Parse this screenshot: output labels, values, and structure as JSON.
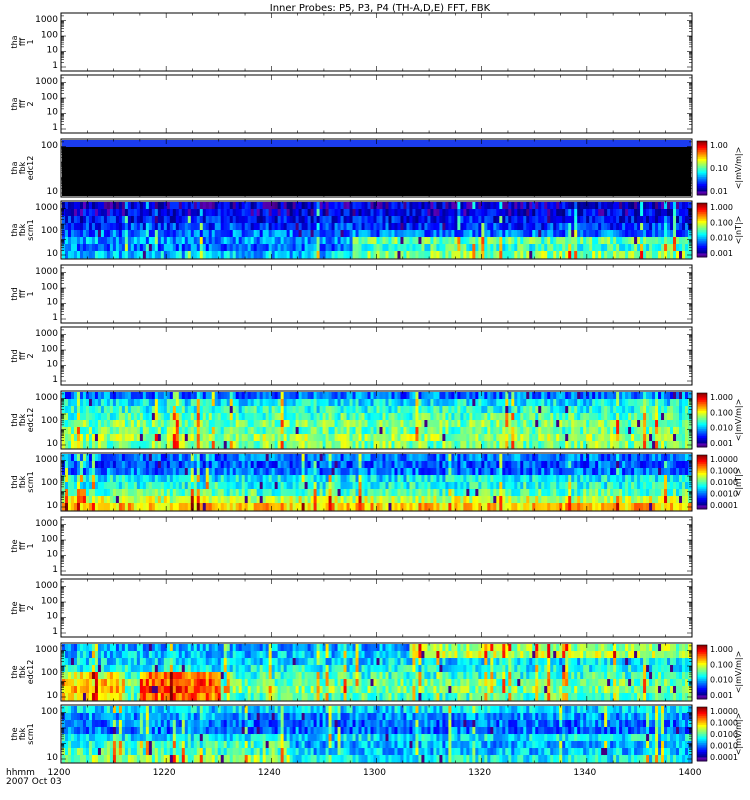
{
  "title": "Inner Probes: P5, P3, P4 (TH-A,D,E) FFT, FBK",
  "footer": {
    "time_label": "hhmm",
    "date_label": "2007 Oct 03"
  },
  "chart_data": {
    "type": "heatmap",
    "x_axis": {
      "ticks": [
        "1200",
        "1220",
        "1240",
        "1300",
        "1320",
        "1340",
        "1400"
      ],
      "range": [
        "12:00",
        "14:00"
      ]
    },
    "panels": [
      {
        "id": "tha-fff1",
        "ylabel": [
          "tha",
          "fff",
          "1"
        ],
        "yticks": [
          "1000",
          "100",
          "10",
          "1"
        ],
        "empty": true
      },
      {
        "id": "tha-fff2",
        "ylabel": [
          "tha",
          "fff",
          "2"
        ],
        "yticks": [
          "1000",
          "100",
          "10",
          "1"
        ],
        "empty": true
      },
      {
        "id": "tha-fbk-edc12",
        "ylabel": [
          "tha",
          "fbk",
          "edc12"
        ],
        "yticks": [
          "100",
          "10"
        ],
        "style": "black",
        "colorbar": {
          "ticks": [
            "1.00",
            "0.10",
            "0.01"
          ],
          "unit": "<|mV/m|>"
        }
      },
      {
        "id": "tha-fbk-scm1",
        "ylabel": [
          "tha",
          "fbk",
          "scm1"
        ],
        "yticks": [
          "1000",
          "100",
          "10"
        ],
        "style": "scmA",
        "colorbar": {
          "ticks": [
            "1.000",
            "0.100",
            "0.010",
            "0.001"
          ],
          "unit": "<|nT|>"
        }
      },
      {
        "id": "thd-fff1",
        "ylabel": [
          "thd",
          "fff",
          "1"
        ],
        "yticks": [
          "1000",
          "100",
          "10",
          "1"
        ],
        "empty": true
      },
      {
        "id": "thd-fff2",
        "ylabel": [
          "thd",
          "fff",
          "2"
        ],
        "yticks": [
          "1000",
          "100",
          "10",
          "1"
        ],
        "empty": true
      },
      {
        "id": "thd-fbk-edc12",
        "ylabel": [
          "thd",
          "fbk",
          "edc12"
        ],
        "yticks": [
          "1000",
          "100",
          "10"
        ],
        "style": "edcD",
        "colorbar": {
          "ticks": [
            "1.000",
            "0.100",
            "0.010",
            "0.001"
          ],
          "unit": "<|mV/m|>"
        }
      },
      {
        "id": "thd-fbk-scm1",
        "ylabel": [
          "thd",
          "fbk",
          "scm1"
        ],
        "yticks": [
          "1000",
          "100",
          "10"
        ],
        "style": "scmD",
        "colorbar": {
          "ticks": [
            "1.0000",
            "0.1000",
            "0.0100",
            "0.0010",
            "0.0001"
          ],
          "unit": "<|nT|>"
        }
      },
      {
        "id": "the-fff1",
        "ylabel": [
          "the",
          "fff",
          "1"
        ],
        "yticks": [
          "1000",
          "100",
          "10",
          "1"
        ],
        "empty": true
      },
      {
        "id": "the-fff2",
        "ylabel": [
          "the",
          "fff",
          "2"
        ],
        "yticks": [
          "1000",
          "100",
          "10",
          "1"
        ],
        "empty": true
      },
      {
        "id": "the-fbk-edc12",
        "ylabel": [
          "the",
          "fbk",
          "edc12"
        ],
        "yticks": [
          "1000",
          "100",
          "10"
        ],
        "style": "edcE",
        "colorbar": {
          "ticks": [
            "1.000",
            "0.100",
            "0.010",
            "0.001"
          ],
          "unit": "<|mV/m|>"
        }
      },
      {
        "id": "the-fbk-scm1",
        "ylabel": [
          "the",
          "fbk",
          "scm1"
        ],
        "yticks": [
          "100",
          "10"
        ],
        "style": "scmE",
        "colorbar": {
          "ticks": [
            "1.0000",
            "0.1000",
            "0.0100",
            "0.0010",
            "0.0001"
          ],
          "unit": "<|mV/m|>"
        }
      }
    ]
  }
}
